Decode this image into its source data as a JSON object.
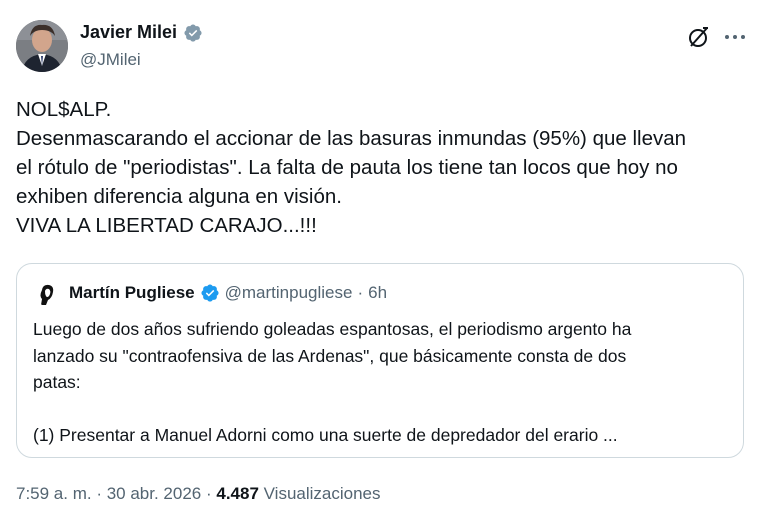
{
  "author": {
    "name": "Javier Milei",
    "handle": "@JMilei",
    "verified": true,
    "verified_color": "#1d9bf0"
  },
  "header": {
    "grok_icon": "grok-icon",
    "more_icon": "more-options-icon"
  },
  "tweet": {
    "lines": [
      "NOL$ALP.",
      "Desenmascarando el accionar de las basuras inmundas (95%) que llevan",
      "el rótulo de \"periodistas\".  La falta de pauta los tiene tan locos que hoy no",
      "exhiben diferencia alguna en visión.",
      "VIVA LA LIBERTAD CARAJO...!!!"
    ]
  },
  "quote": {
    "name": "Martín Pugliese",
    "handle": "@martinpugliese",
    "separator": "·",
    "time": "6h",
    "lines": [
      "Luego de dos años sufriendo goleadas espantosas, el periodismo argento ha",
      "lanzado su \"contraofensiva de las Ardenas\", que básicamente consta de dos",
      "patas:",
      "(1) Presentar a Manuel Adorni como una suerte de depredador del erario ..."
    ]
  },
  "meta": {
    "time": "7:59 a. m.",
    "sep1": " · ",
    "date": "30 abr. 2026",
    "sep2": " · ",
    "views_count": "4.487",
    "views_label": " Visualizaciones"
  }
}
